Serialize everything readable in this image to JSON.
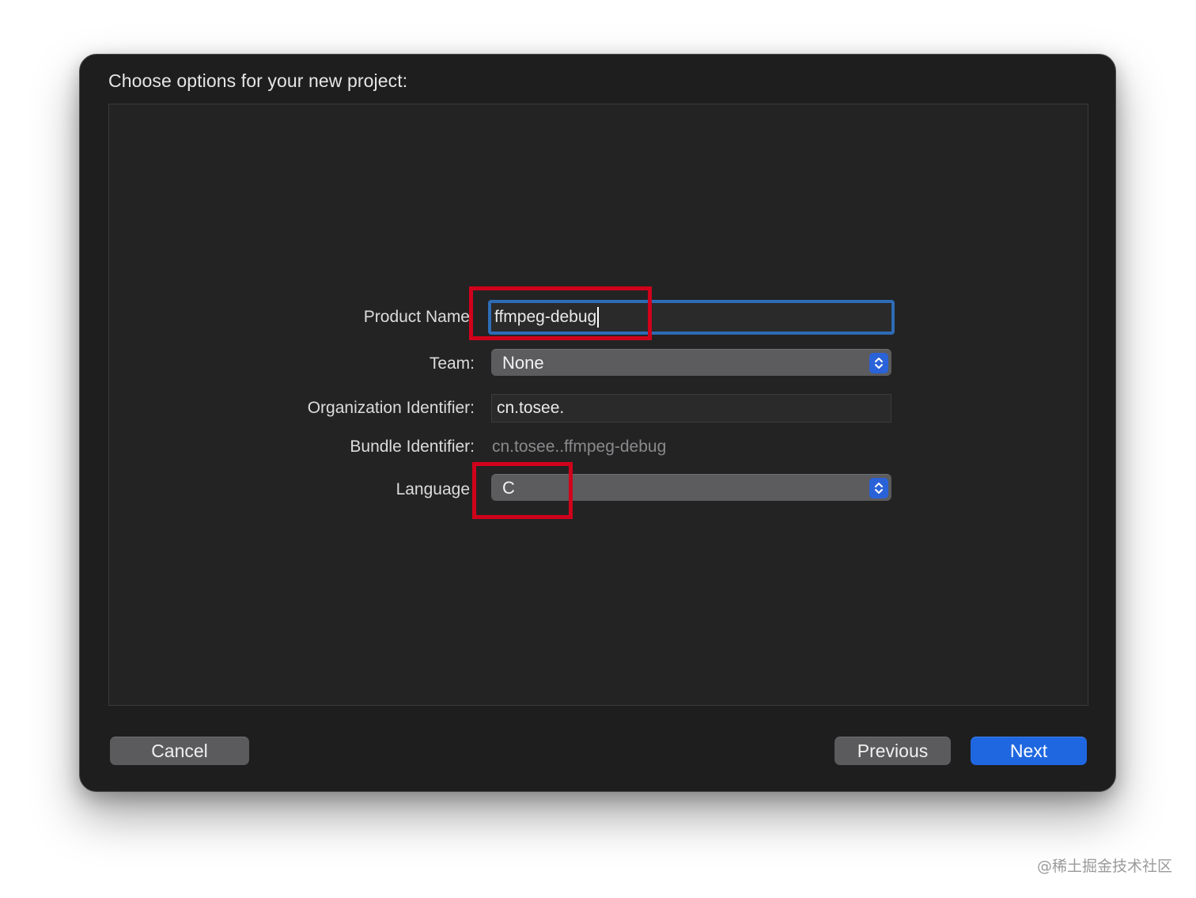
{
  "dialog": {
    "title": "Choose options for your new project:"
  },
  "form": {
    "product_name": {
      "label": "Product Name",
      "value": "ffmpeg-debug"
    },
    "team": {
      "label": "Team:",
      "value": "None"
    },
    "organization_identifier": {
      "label": "Organization Identifier:",
      "value": "cn.tosee."
    },
    "bundle_identifier": {
      "label": "Bundle Identifier:",
      "value": "cn.tosee..ffmpeg-debug"
    },
    "language": {
      "label": "Language",
      "value": "C"
    }
  },
  "buttons": {
    "cancel": "Cancel",
    "previous": "Previous",
    "next": "Next"
  },
  "watermark": "@稀土掘金技术社区",
  "colors": {
    "dialog_background": "#1e1e1f",
    "accent_blue": "#1f67e0",
    "focus_ring": "#2e6cb6",
    "annotation_red": "#d0021b"
  },
  "icons": {
    "popup_stepper": "chevron-up-down-icon"
  }
}
